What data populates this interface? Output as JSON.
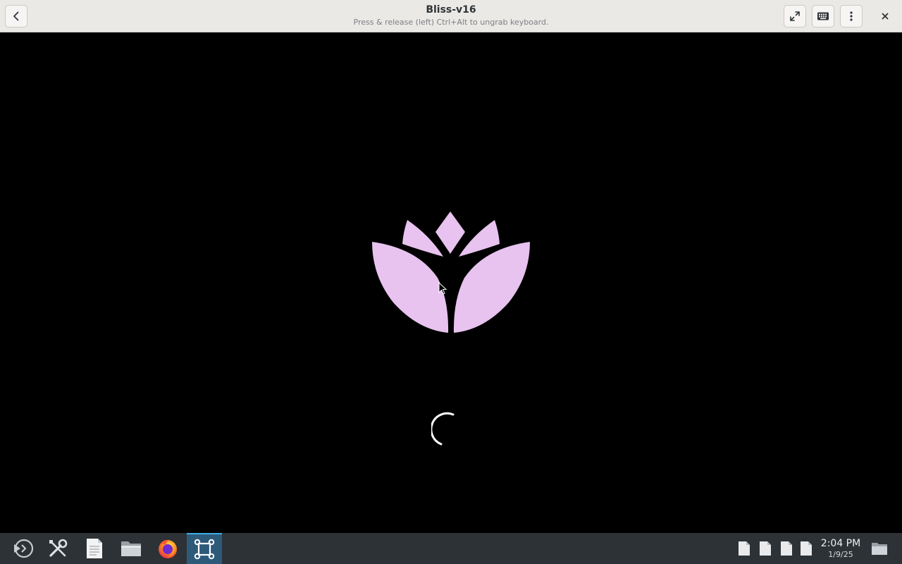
{
  "titlebar": {
    "title": "Bliss-v16",
    "subtitle": "Press & release (left) Ctrl+Alt to ungrab keyboard.",
    "buttons": {
      "back": "go-back-icon",
      "fullscreen": "fullscreen-icon",
      "keyboard": "keyboard-icon",
      "menu": "more-options-icon",
      "close": "close-icon"
    }
  },
  "guest_screen": {
    "logo": "lotus-logo",
    "logo_color": "#e8c3ef",
    "spinner": "loading-spinner",
    "background": "#000000"
  },
  "taskbar": {
    "launchers": [
      {
        "name": "application-launcher",
        "icon": "launcher-icon"
      },
      {
        "name": "system-settings",
        "icon": "tools-icon"
      },
      {
        "name": "text-editor",
        "icon": "document-icon"
      },
      {
        "name": "file-manager",
        "icon": "folder-icon"
      },
      {
        "name": "firefox",
        "icon": "firefox-icon"
      },
      {
        "name": "virtual-machine-manager",
        "icon": "vm-icon",
        "active": true
      }
    ],
    "tray": {
      "icons": [
        "document-icon",
        "document-icon",
        "document-icon",
        "document-icon"
      ],
      "clock": {
        "time": "2:04 PM",
        "date": "1/9/25"
      },
      "show_desktop": "show-desktop-icon"
    }
  }
}
